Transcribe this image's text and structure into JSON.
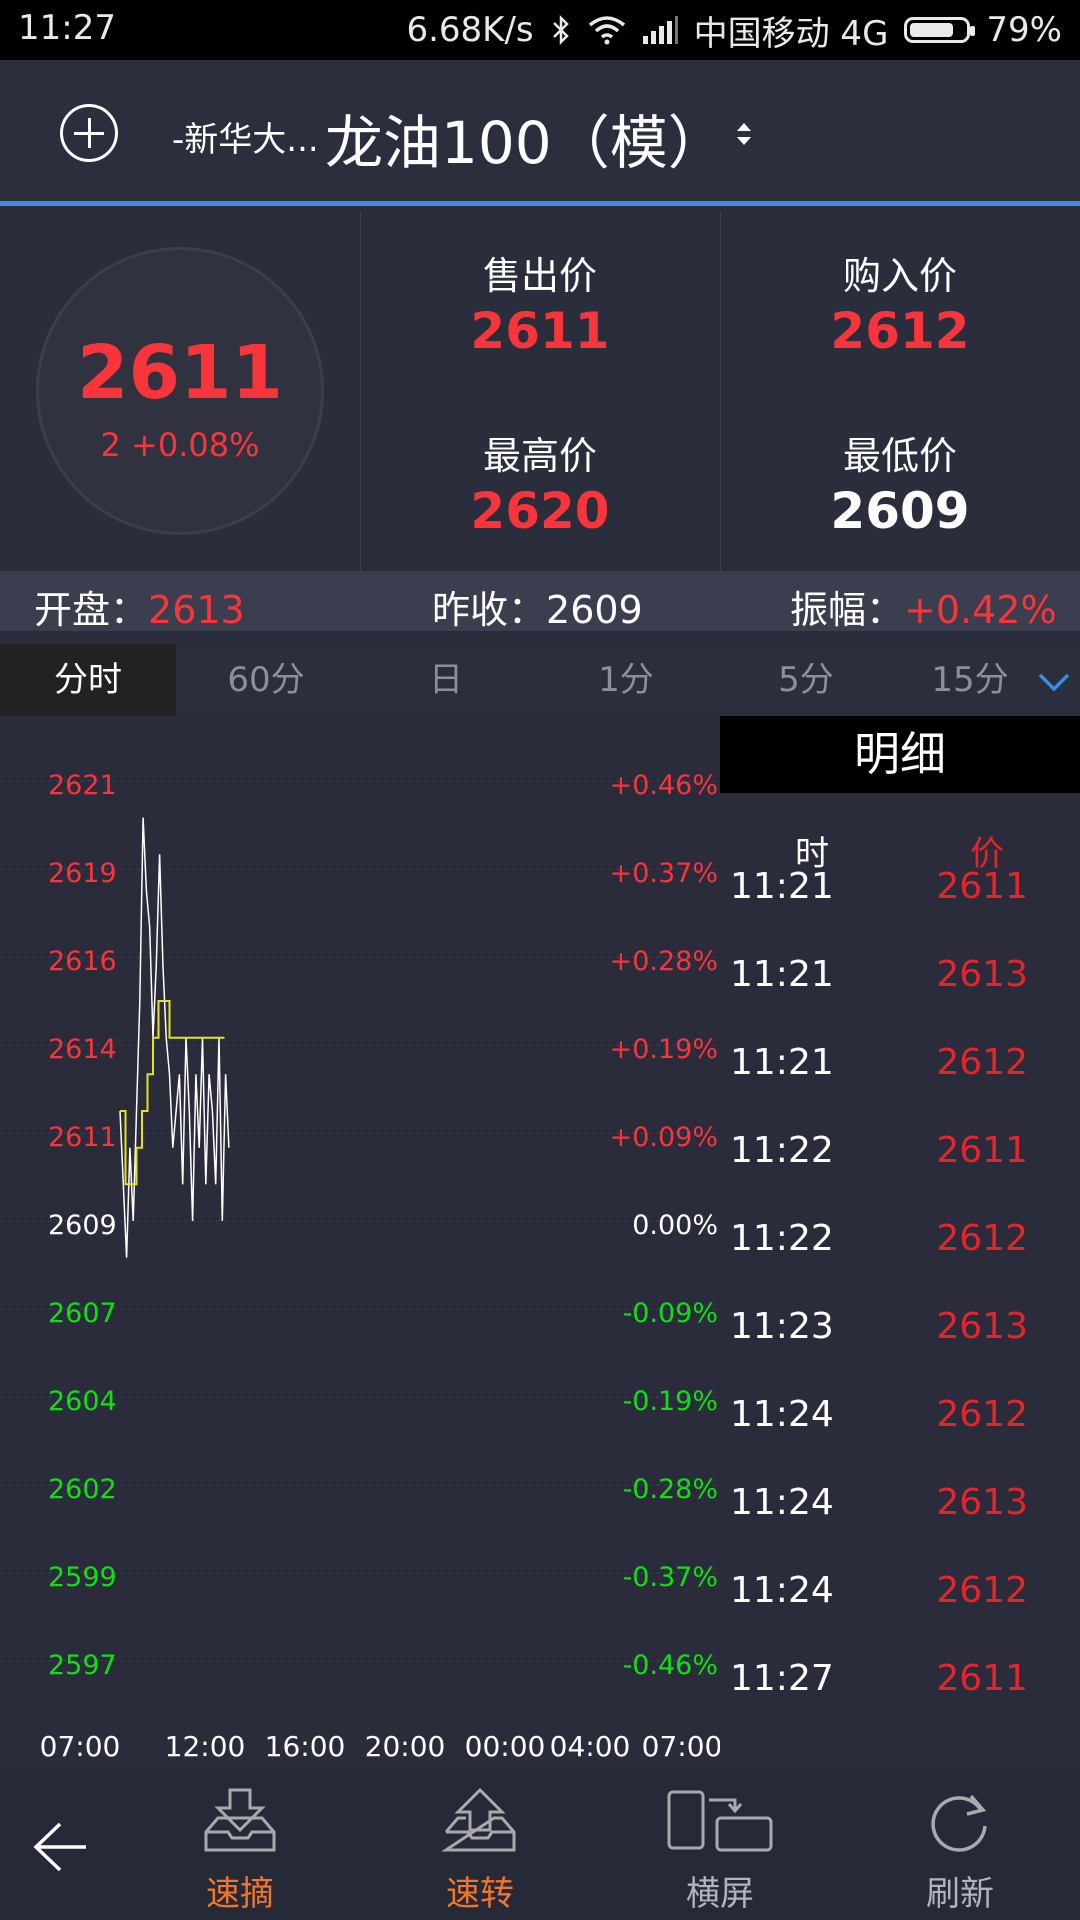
{
  "status_bar": {
    "time": "11:27",
    "network_speed": "6.68K/s",
    "carrier": "中国移动 4G",
    "battery": "79%",
    "battery_level": 0.79,
    "icons": [
      "bluetooth-icon",
      "wifi-icon",
      "signal-icon",
      "battery-icon"
    ]
  },
  "header": {
    "exchange": "-新华大...",
    "product": "龙油100（模）"
  },
  "quote": {
    "last_price": "2611",
    "change": "2  +0.08%",
    "sell_label": "售出价",
    "sell_value": "2611",
    "buy_label": "购入价",
    "buy_value": "2612",
    "high_label": "最高价",
    "high_value": "2620",
    "low_label": "最低价",
    "low_value": "2609"
  },
  "summary": {
    "open_label": "开盘：",
    "open_value": "2613",
    "prev_close_label": "昨收：",
    "prev_close_value": "2609",
    "amplitude_label": "振幅：",
    "amplitude_value": "+0.42%"
  },
  "tabs": [
    {
      "label": "分时",
      "active": true
    },
    {
      "label": "60分",
      "active": false
    },
    {
      "label": "日",
      "active": false
    },
    {
      "label": "1分",
      "active": false
    },
    {
      "label": "5分",
      "active": false
    },
    {
      "label": "15分",
      "active": false
    }
  ],
  "chart_data": {
    "type": "line",
    "title": "",
    "y_labels": [
      "2621",
      "2619",
      "2616",
      "2614",
      "2611",
      "2609",
      "2607",
      "2604",
      "2602",
      "2599",
      "2597"
    ],
    "pct_labels": [
      "+0.46%",
      "+0.37%",
      "+0.28%",
      "+0.19%",
      "+0.09%",
      "0.00%",
      "-0.09%",
      "-0.19%",
      "-0.28%",
      "-0.37%",
      "-0.46%"
    ],
    "x_labels": [
      "07:00",
      "12:00",
      "16:00",
      "20:00",
      "00:00",
      "04:00",
      "07:00"
    ],
    "ylim": [
      2597,
      2621
    ],
    "reference": 2609,
    "series": [
      {
        "color": "#ffffff",
        "values": [
          2612,
          2610,
          2608,
          2611,
          2609,
          2612,
          2615,
          2620,
          2618,
          2617,
          2614,
          2616,
          2619,
          2616,
          2614,
          2613,
          2611,
          2612,
          2613,
          2610,
          2614,
          2612,
          2609,
          2613,
          2611,
          2614,
          2610,
          2613,
          2612,
          2610,
          2614,
          2609,
          2613,
          2611
        ]
      },
      {
        "color": "#e7e21e",
        "values": [
          2612,
          2610,
          2610,
          2611,
          2612,
          2613,
          2614,
          2615,
          2615,
          2614,
          2614,
          2614,
          2614,
          2614,
          2614,
          2614,
          2614,
          2614,
          2614,
          2614
        ]
      }
    ],
    "up_color": "#f7353a",
    "flat_color": "#ffffff",
    "down_color": "#10e010"
  },
  "detail": {
    "title": "明细",
    "col_time": "时",
    "col_price": "价",
    "rows": [
      {
        "time": "11:21",
        "price": "2611"
      },
      {
        "time": "11:21",
        "price": "2613"
      },
      {
        "time": "11:21",
        "price": "2612"
      },
      {
        "time": "11:22",
        "price": "2611"
      },
      {
        "time": "11:22",
        "price": "2612"
      },
      {
        "time": "11:23",
        "price": "2613"
      },
      {
        "time": "11:24",
        "price": "2612"
      },
      {
        "time": "11:24",
        "price": "2613"
      },
      {
        "time": "11:24",
        "price": "2612"
      },
      {
        "time": "11:27",
        "price": "2611"
      }
    ]
  },
  "bottom_bar": {
    "items": [
      {
        "label": "速摘"
      },
      {
        "label": "速转"
      },
      {
        "label": "横屏"
      },
      {
        "label": "刷新"
      }
    ]
  },
  "colors": {
    "up": "#f7353a",
    "down": "#10e010",
    "accent": "#3d8ae0",
    "active_action": "#f0762b"
  }
}
